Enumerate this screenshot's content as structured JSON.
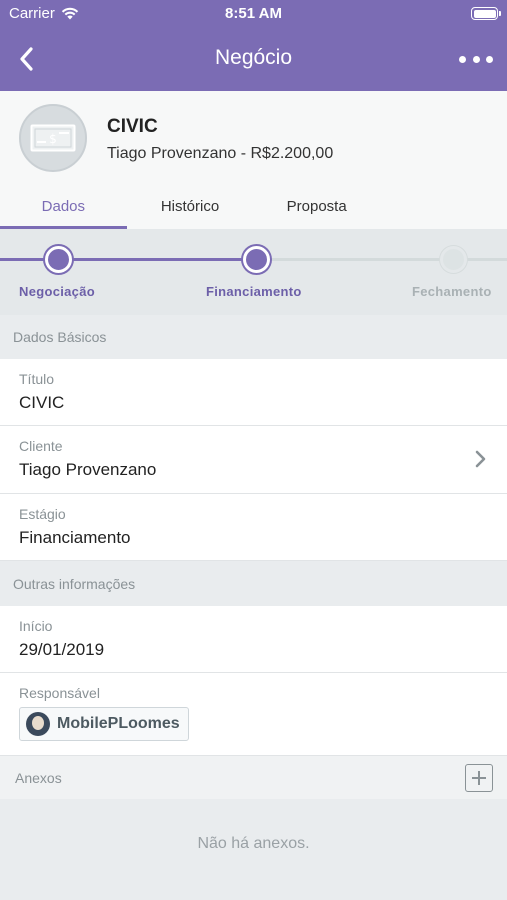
{
  "status_bar": {
    "carrier": "Carrier",
    "time": "8:51 AM"
  },
  "nav": {
    "title": "Negócio",
    "back_icon": "chevron-left-icon",
    "more_icon": "more-horizontal-icon"
  },
  "deal": {
    "name": "CIVIC",
    "subtitle": "Tiago Provenzano - R$2.200,00",
    "icon": "money-bill-icon"
  },
  "tabs": [
    {
      "label": "Dados",
      "active": true
    },
    {
      "label": "Histórico",
      "active": false
    },
    {
      "label": "Proposta",
      "active": false
    }
  ],
  "stages": [
    {
      "label": "Negociação",
      "state": "done"
    },
    {
      "label": "Financiamento",
      "state": "current"
    },
    {
      "label": "Fechamento",
      "state": "pending"
    }
  ],
  "dados_basicos": {
    "header": "Dados Básicos",
    "titulo": {
      "label": "Título",
      "value": "CIVIC"
    },
    "cliente": {
      "label": "Cliente",
      "value": "Tiago Provenzano"
    },
    "estagio": {
      "label": "Estágio",
      "value": "Financiamento"
    }
  },
  "outras": {
    "header": "Outras informações",
    "inicio": {
      "label": "Início",
      "value": "29/01/2019"
    },
    "responsavel": {
      "label": "Responsável",
      "value": "MobilePLoomes"
    }
  },
  "anexos": {
    "header": "Anexos",
    "empty_text": "Não há anexos."
  },
  "colors": {
    "accent": "#7b6cb4",
    "muted_text": "#8a9296",
    "background": "#e9ecee"
  }
}
